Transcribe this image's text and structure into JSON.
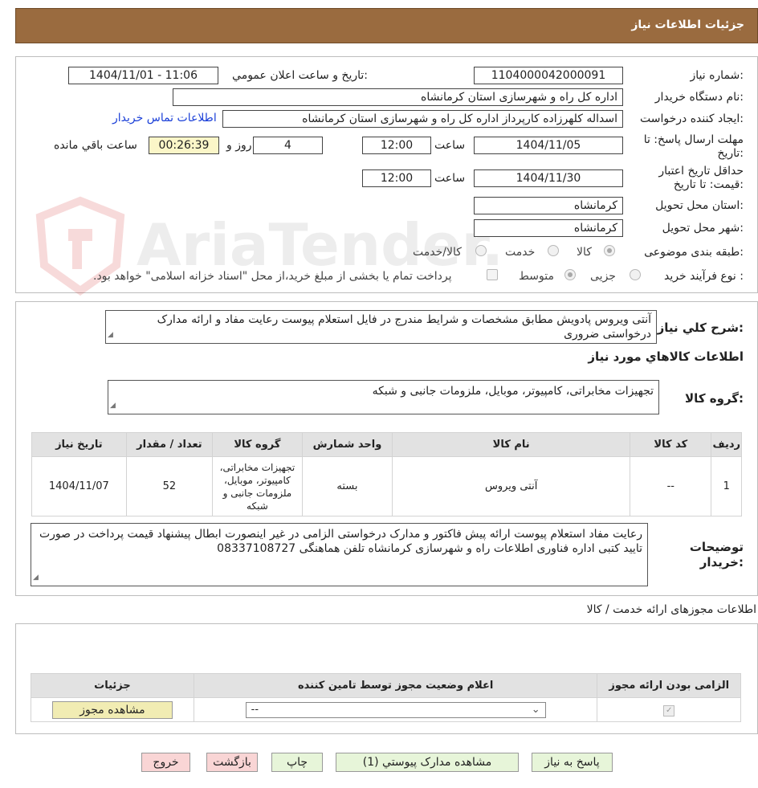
{
  "header": {
    "title": "جزئیات اطلاعات نیاز"
  },
  "watermark": {
    "text": "AriaTender.neT"
  },
  "info": {
    "need_number_label": "شماره نیاز:",
    "need_number": "1104000042000091",
    "announce_label": "تاریخ و ساعت اعلان عمومي:",
    "announce_value": "1404/11/01 - 11:06",
    "buyer_org_label": "نام دستگاه خریدار:",
    "buyer_org": "اداره کل راه و شهرسازی استان کرمانشاه",
    "requester_label": "ایجاد کننده درخواست:",
    "requester": "اسداله کلهرزاده کارپرداز اداره کل راه و شهرسازی استان کرمانشاه",
    "contact_link": "اطلاعات تماس خریدار",
    "deadline_label_1": "مهلت ارسال پاسخ: تا",
    "deadline_label_2": "تاریخ:",
    "deadline_date": "1404/11/05",
    "time_label": "ساعت",
    "deadline_time": "12:00",
    "days_value": "4",
    "days_label": "روز و",
    "remaining_time": "00:26:39",
    "remaining_label": "ساعت باقي مانده",
    "validity_label_1": "حداقل تاریخ اعتبار",
    "validity_label_2": "قیمت: تا تاریخ:",
    "validity_date": "1404/11/30",
    "validity_time": "12:00",
    "province_label": "استان محل تحویل:",
    "province": "کرمانشاه",
    "city_label": "شهر محل تحویل:",
    "city": "کرمانشاه",
    "category_label": "طبقه بندی موضوعی:",
    "category_options": [
      "کالا",
      "خدمت",
      "کالا/خدمت"
    ],
    "category_selected": "کالا",
    "process_label": "نوع فرآیند خرید :",
    "process_options": [
      "جزیی",
      "متوسط"
    ],
    "process_selected": "متوسط",
    "payment_note": "پرداخت تمام یا بخشی از مبلغ خرید،از محل \"اسناد خزانه اسلامی\" خواهد بود."
  },
  "description": {
    "label": "شرح کلي نياز:",
    "text": "آنتی ویروس پادویش مطابق مشخصات و شرایط مندرج در فایل استعلام پیوست رعایت مفاد و ارائه مدارک درخواستی ضروری"
  },
  "goods": {
    "section_title": "اطلاعات کالاهاي مورد نياز",
    "group_label": "گروه کالا:",
    "group_value": "تجهیزات مخابراتی، کامپیوتر، موبایل، ملزومات جانبی و شبکه",
    "columns": [
      "رديف",
      "کد کالا",
      "نام کالا",
      "واحد شمارش",
      "گروه کالا",
      "تعداد / مقدار",
      "تاریخ نیاز"
    ],
    "rows": [
      {
        "index": "1",
        "code": "--",
        "name": "آنتی ویروس",
        "unit": "بسته",
        "group": "تجهیزات مخابراتی، کامپیوتر، موبایل، ملزومات جانبی و شبکه",
        "qty": "52",
        "date": "1404/11/07"
      }
    ]
  },
  "buyer_notes": {
    "label_1": "توضیحات",
    "label_2": "خریدار:",
    "text": "رعایت مفاد استعلام پیوست ارائه پیش فاکتور و مدارک درخواستی الزامی در غیر اینصورت ابطال پیشنهاد قیمت پرداخت در صورت تایید کتبی اداره فناوری اطلاعات راه و شهرسازی کرمانشاه تلفن هماهنگی 08337108727"
  },
  "licenses": {
    "section_title": "اطلاعات مجوزهای ارائه خدمت / کالا",
    "columns": [
      "الزامی بودن ارائه مجوز",
      "اعلام وضعیت مجوز توسط تامین کننده",
      "جزئیات"
    ],
    "row": {
      "select_value": "--",
      "view_button": "مشاهده مجوز"
    }
  },
  "actions": {
    "reply": "پاسخ به نیاز",
    "attachments": "مشاهده مدارک پیوستي (1)",
    "print": "چاپ",
    "back": "بازگشت",
    "exit": "خروج"
  }
}
